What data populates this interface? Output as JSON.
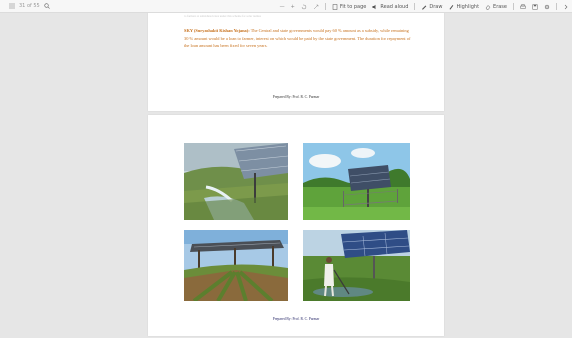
{
  "toolbar": {
    "page_nav": "31  of 55",
    "zoom_out": "—",
    "zoom_in": "+",
    "fit_label": "Fit to page",
    "read_aloud": "Read aloud",
    "draw": "Draw",
    "highlight": "Highlight",
    "erase": "Erase"
  },
  "document": {
    "page1": {
      "faint_text": "to farmers at subsidized rates under this scheme for solar pumps",
      "bold_lead": "SKY (Suryashakti Kishan Yojana):",
      "body": " The Central and state governments would pay 60 % amount as a subsidy, while remaining 30 % amount would be a loan to farmer, interest on which would be paid by the state government. The duration for repayment of the loan amount has been fixed for seven years.",
      "prepared_by": "Prepared By: Prof. R. C. Parmar"
    },
    "page2": {
      "photos": [
        "solar-pump-irrigation-photo",
        "solar-panel-field-photo",
        "agrivoltaic-vineyard-photo",
        "farmer-with-solar-pump-photo"
      ],
      "prepared_by": "Prepared By: Prof. R. C. Parmar"
    }
  }
}
